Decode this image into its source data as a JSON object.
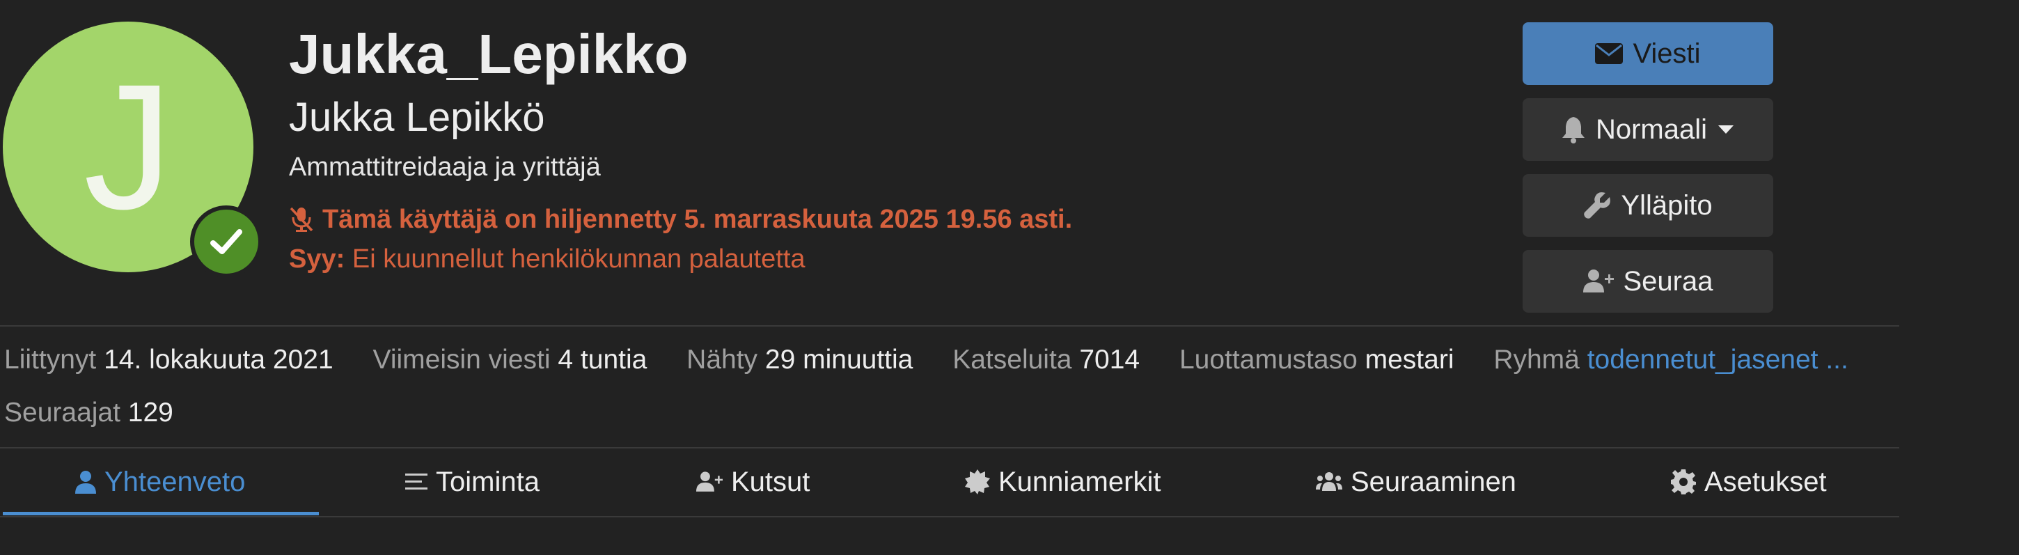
{
  "profile": {
    "avatar_letter": "J",
    "avatar_color": "#a3d56a",
    "verified_color": "#4f8f27",
    "username": "Jukka_Lepikko",
    "full_name": "Jukka Lepikkö",
    "title": "Ammattitreidaaja ja yrittäjä",
    "silenced_notice": "Tämä käyttäjä on hiljennetty 5. marraskuuta 2025 19.56 asti.",
    "reason_label": "Syy:",
    "reason_text": "Ei kuunnellut henkilökunnan palautetta"
  },
  "actions": {
    "message": {
      "label": "Viesti",
      "icon": "envelope-icon"
    },
    "notification": {
      "label": "Normaali",
      "icon": "bell-icon"
    },
    "admin": {
      "label": "Ylläpito",
      "icon": "wrench-icon"
    },
    "follow": {
      "label": "Seuraa",
      "icon": "user-plus-icon"
    }
  },
  "stats": {
    "joined_label": "Liittynyt",
    "joined_value": "14. lokakuuta 2021",
    "last_post_label": "Viimeisin viesti",
    "last_post_value": "4 tuntia",
    "seen_label": "Nähty",
    "seen_value": "29 minuuttia",
    "views_label": "Katseluita",
    "views_value": "7014",
    "trust_label": "Luottamustaso",
    "trust_value": "mestari",
    "group_label": "Ryhmä",
    "group_value": "todennetut_jasenet ...",
    "followers_label": "Seuraajat",
    "followers_value": "129"
  },
  "tabs": [
    {
      "label": "Yhteenveto",
      "icon": "user-icon",
      "active": true
    },
    {
      "label": "Toiminta",
      "icon": "list-icon",
      "active": false
    },
    {
      "label": "Kutsut",
      "icon": "user-plus-icon",
      "active": false
    },
    {
      "label": "Kunniamerkit",
      "icon": "badge-icon",
      "active": false
    },
    {
      "label": "Seuraaminen",
      "icon": "users-icon",
      "active": false
    },
    {
      "label": "Asetukset",
      "icon": "gear-icon",
      "active": false
    }
  ],
  "colors": {
    "background": "#222222",
    "accent": "#4a8ed1",
    "primary_button": "#4a7fb8",
    "warning": "#d5613e"
  }
}
